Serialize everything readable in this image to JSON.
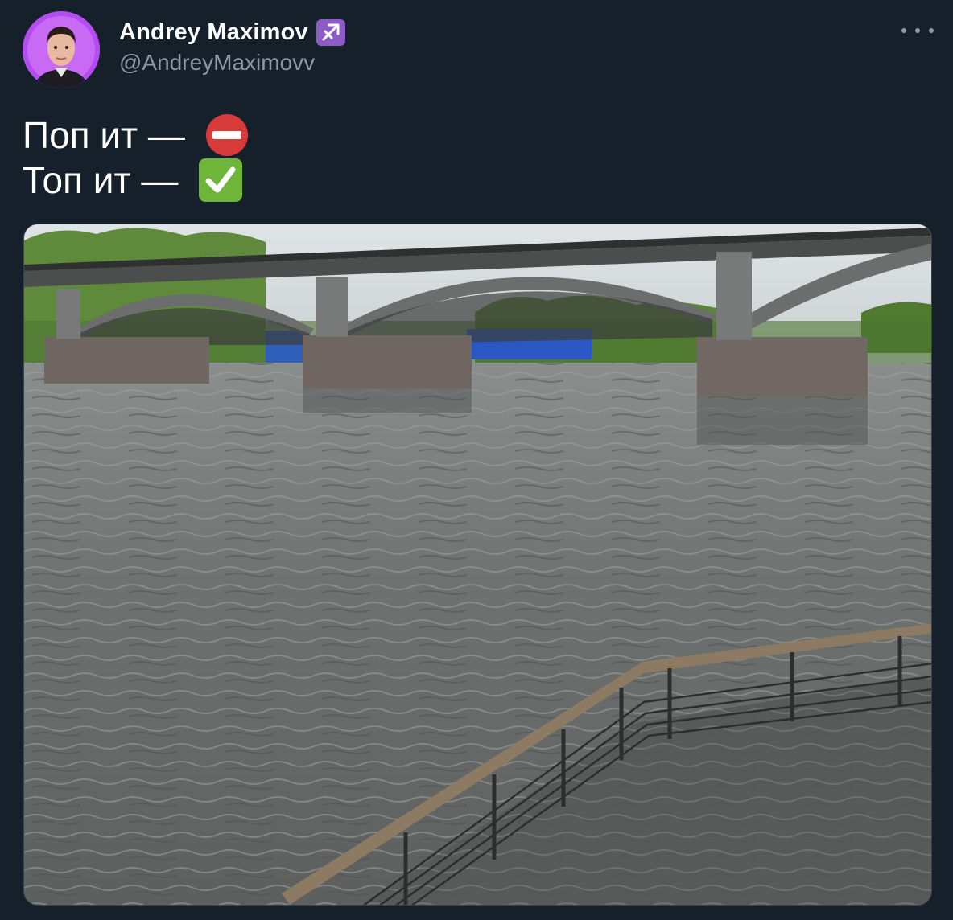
{
  "author": {
    "name": "Andrey Maximov",
    "handle": "@AndreyMaximovv",
    "badge_icon": "sagittarius-icon"
  },
  "tweet": {
    "lines": [
      "Поп ит — ",
      "Топ ит — "
    ],
    "line_icons": [
      "no-entry-icon",
      "check-mark-button-icon"
    ]
  },
  "colors": {
    "background": "#15202b",
    "secondary_text": "#8b98a5",
    "badge": "#8b5cc6",
    "no_entry": "#d93a3a",
    "check": "#6fb53a"
  },
  "media": {
    "alt": ""
  }
}
